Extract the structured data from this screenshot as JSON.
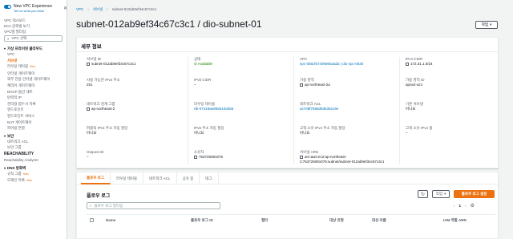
{
  "sidebar": {
    "nve_title": "New VPC Experience",
    "nve_sub": "Tell us what you think",
    "dashboard": "VPC 대시보드",
    "ec2_global": "EC2 글로벌 보기",
    "filter_label": "VPC별 필터링:",
    "vpc_select_placeholder": "VPC 선택",
    "section_vpc": "가상 프라이빗 클라우드",
    "vpc_items": [
      "VPC",
      "서브넷",
      "라우팅 테이블",
      "인터넷 게이트웨이",
      "외부 전용 인터넷 게이트웨이",
      "캐리어 게이트웨이",
      "DHCP 옵션 세트",
      "탄력적 IP",
      "관리형 접두사 목록",
      "엔드포인트",
      "엔드포인트 서비스",
      "NAT 게이트웨이",
      "피어링 연결"
    ],
    "new_badge": "New",
    "section_security": "보안",
    "security_items": [
      "네트워크 ACL",
      "보안 그룹"
    ],
    "reachability": "REACHABILITY",
    "reachability_analyzer": "Reachability Analyzer",
    "section_dns": "DNS 방화벽",
    "dns_items": [
      "규칙 그룹",
      "도메인 목록"
    ]
  },
  "breadcrumb": [
    "VPC",
    "서브넷",
    "subnet-012ab9ef34c67c3c1"
  ],
  "page_title": "subnet-012ab9ef34c67c3c1 / dio-subnet-01",
  "actions_label": "작업",
  "details": {
    "title": "세부 정보",
    "columns": [
      [
        {
          "label": "서브넷 ID",
          "value": "subnet-012ab9ef34c67c3c1",
          "copy": true
        },
        {
          "label": "사용 가능한 IPv4 주소",
          "value": "251"
        },
        {
          "label": "네트워크 경계 그룹",
          "value": "ap-northeast-2",
          "copy": true
        },
        {
          "label": "퍼블릭 IPv4 주소 자동 할당",
          "value": "아니요"
        },
        {
          "label": "Outpost ID",
          "value": "–"
        }
      ],
      [
        {
          "label": "상태",
          "value": "Available",
          "status": "ok"
        },
        {
          "label": "IPv6 CIDR",
          "value": "–"
        },
        {
          "label": "라우팅 테이블",
          "value": "rtb-07419ae855610d455",
          "link": true
        },
        {
          "label": "IPv6 주소 자동 할당",
          "value": "아니요"
        },
        {
          "label": "소유자",
          "value": "763725081076",
          "copy": true
        }
      ],
      [
        {
          "label": "VPC",
          "value": "vpc-055cf574069ebaada | dio-vpc-0630",
          "link": true
        },
        {
          "label": "가용 영역",
          "value": "ap-northeast-2a",
          "copy": true
        },
        {
          "label": "네트워크 ACL",
          "value": "acl-08f7558d0d5352c9e",
          "link": true
        },
        {
          "label": "고객 소유 IPv4 주소 자동 할당",
          "value": "아니요"
        },
        {
          "label": "서브넷 ARN",
          "value": "arn:aws:ec2:ap-northeast-2:763725081076:subnet/subnet-012ab9ef34c67c3c1",
          "copy": true
        }
      ],
      [
        {
          "label": "IPv4 CIDR",
          "value": "172.31.1.0/24",
          "copy": true
        },
        {
          "label": "가용 영역 ID",
          "value": "apne2-az1"
        },
        {
          "label": "기본 서브넷",
          "value": "아니요"
        },
        {
          "label": "고객 소유 IPv4 풀",
          "value": "–"
        }
      ]
    ]
  },
  "tabs": [
    "플로우 로그",
    "라우팅 테이블",
    "네트워크 ACL",
    "공유 중",
    "태그"
  ],
  "flow": {
    "title": "플로우 로그",
    "actions_label": "작업",
    "create_label": "플로우 로그 생성",
    "search_placeholder": "플로우 로그 필터링",
    "page": "1",
    "columns": [
      "Name",
      "플로우 로그 ID",
      "필터",
      "대상 유형",
      "대상 이름",
      "IAM 역할 ARN"
    ]
  }
}
